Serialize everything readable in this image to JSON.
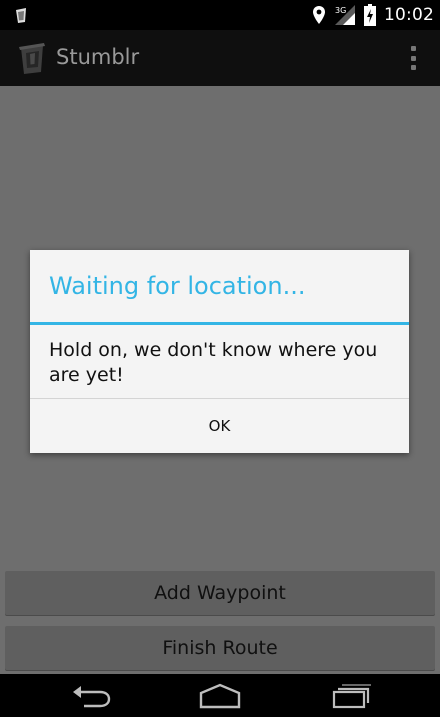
{
  "status_bar": {
    "time": "10:02",
    "network_label": "3G",
    "icons": [
      "notification-app-icon",
      "location-pin-icon",
      "signal-icon",
      "battery-charging-icon"
    ]
  },
  "action_bar": {
    "title": "Stumblr",
    "icon": "trash-can-app-icon",
    "overflow_icon": "overflow-menu-icon"
  },
  "buttons": {
    "add_waypoint": "Add Waypoint",
    "finish_route": "Finish Route"
  },
  "dialog": {
    "title": "Waiting for location...",
    "message": "Hold on, we don't know where you are yet!",
    "ok_label": "OK"
  },
  "nav_bar": {
    "icons": [
      "back-icon",
      "home-icon",
      "recents-icon"
    ]
  },
  "colors": {
    "accent": "#33b5e5",
    "dim_background": "#6e6e6e",
    "dialog_background": "#f4f4f4"
  }
}
